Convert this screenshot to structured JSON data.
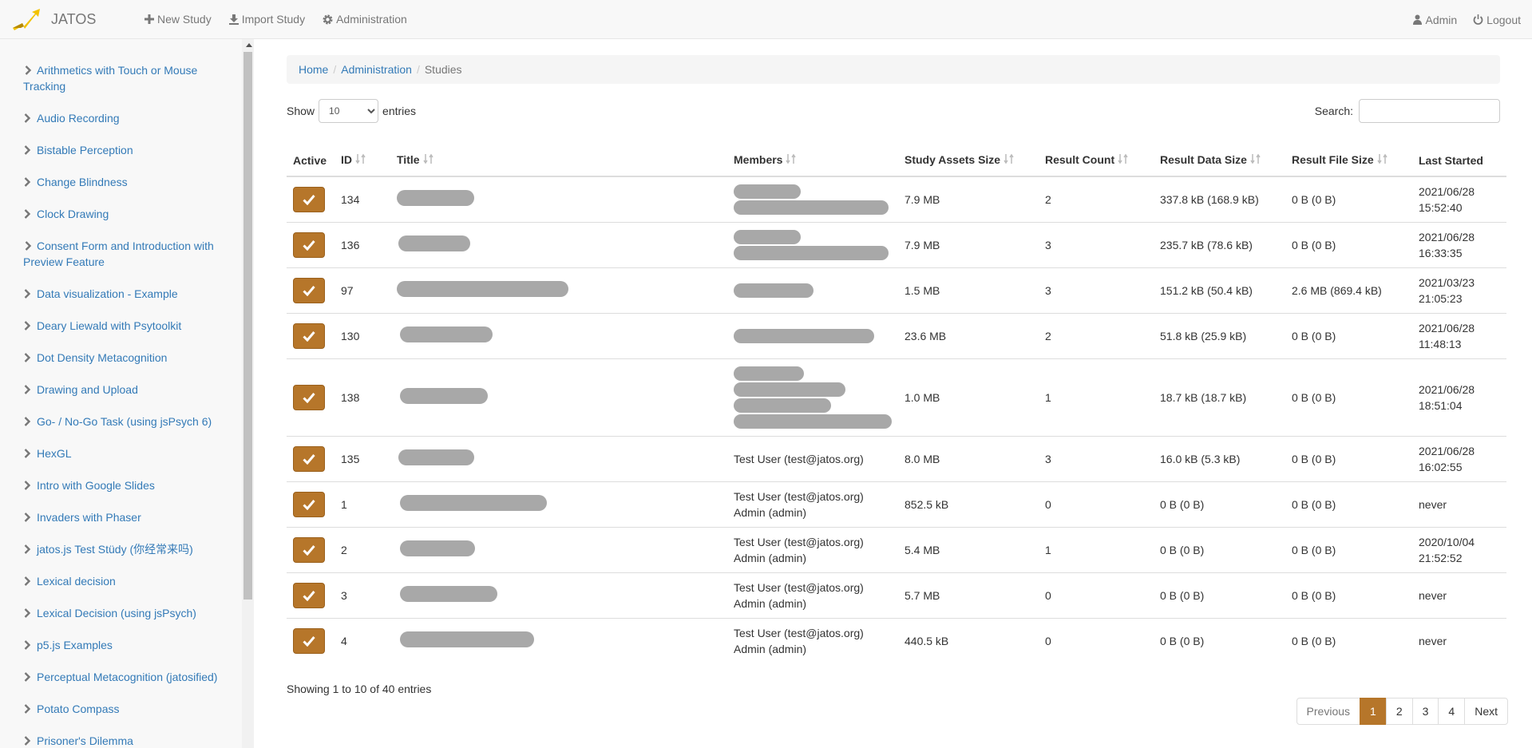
{
  "navbar": {
    "brand": "JATOS",
    "new_study": "New Study",
    "import_study": "Import Study",
    "administration": "Administration",
    "user": "Admin",
    "logout": "Logout"
  },
  "sidebar": {
    "items": [
      {
        "label": "Arithmetics with Touch or Mouse Tracking"
      },
      {
        "label": "Audio Recording"
      },
      {
        "label": "Bistable Perception"
      },
      {
        "label": "Change Blindness"
      },
      {
        "label": "Clock Drawing"
      },
      {
        "label": "Consent Form and Introduction with Preview Feature"
      },
      {
        "label": "Data visualization - Example"
      },
      {
        "label": "Deary Liewald with Psytoolkit"
      },
      {
        "label": "Dot Density Metacognition"
      },
      {
        "label": "Drawing and Upload"
      },
      {
        "label": "Go- / No-Go Task (using jsPsych 6)"
      },
      {
        "label": "HexGL"
      },
      {
        "label": "Intro with Google Slides"
      },
      {
        "label": "Invaders with Phaser"
      },
      {
        "label": "jatos.js Test Stüdy (你经常来吗)"
      },
      {
        "label": "Lexical decision"
      },
      {
        "label": "Lexical Decision (using jsPsych)"
      },
      {
        "label": "p5.js Examples"
      },
      {
        "label": "Perceptual Metacognition (jatosified)"
      },
      {
        "label": "Potato Compass"
      },
      {
        "label": "Prisoner's Dilemma"
      }
    ]
  },
  "breadcrumb": {
    "home": "Home",
    "administration": "Administration",
    "current": "Studies"
  },
  "controls": {
    "show_label": "Show",
    "entries_label": "entries",
    "page_size": "10",
    "search_label": "Search:",
    "search_value": ""
  },
  "table": {
    "headers": {
      "active": "Active",
      "id": "ID",
      "title": "Title",
      "members": "Members",
      "assets": "Study Assets Size",
      "result_count": "Result Count",
      "result_data": "Result Data Size",
      "result_file": "Result File Size",
      "last_started": "Last Started"
    },
    "rows": [
      {
        "id": "134",
        "members": [
          "",
          "",
          "",
          ""
        ],
        "assets": "7.9 MB",
        "count": "2",
        "data": "337.8 kB (168.9 kB)",
        "file": "0 B (0 B)",
        "started1": "2021/06/28",
        "started2": "15:52:40"
      },
      {
        "id": "136",
        "members": [
          "",
          "",
          "",
          ""
        ],
        "assets": "7.9 MB",
        "count": "3",
        "data": "235.7 kB (78.6 kB)",
        "file": "0 B (0 B)",
        "started1": "2021/06/28",
        "started2": "16:33:35"
      },
      {
        "id": "97",
        "members": [
          "",
          "",
          "",
          ""
        ],
        "assets": "1.5 MB",
        "count": "3",
        "data": "151.2 kB (50.4 kB)",
        "file": "2.6 MB (869.4 kB)",
        "started1": "2021/03/23",
        "started2": "21:05:23"
      },
      {
        "id": "130",
        "members": [
          "",
          "",
          "",
          ""
        ],
        "assets": "23.6 MB",
        "count": "2",
        "data": "51.8 kB (25.9 kB)",
        "file": "0 B (0 B)",
        "started1": "2021/06/28",
        "started2": "11:48:13"
      },
      {
        "id": "138",
        "members": [
          "",
          "",
          "",
          ""
        ],
        "assets": "1.0 MB",
        "count": "1",
        "data": "18.7 kB (18.7 kB)",
        "file": "0 B (0 B)",
        "started1": "2021/06/28",
        "started2": "18:51:04"
      },
      {
        "id": "135",
        "members": [
          "Test User (test@jatos.org)",
          ""
        ],
        "assets": "8.0 MB",
        "count": "3",
        "data": "16.0 kB (5.3 kB)",
        "file": "0 B (0 B)",
        "started1": "2021/06/28",
        "started2": "16:02:55"
      },
      {
        "id": "1",
        "members": [
          "Test User (test@jatos.org)",
          "Admin (admin)"
        ],
        "assets": "852.5 kB",
        "count": "0",
        "data": "0 B (0 B)",
        "file": "0 B (0 B)",
        "started1": "never",
        "started2": ""
      },
      {
        "id": "2",
        "members": [
          "Test User (test@jatos.org)",
          "Admin (admin)"
        ],
        "assets": "5.4 MB",
        "count": "1",
        "data": "0 B (0 B)",
        "file": "0 B (0 B)",
        "started1": "2020/10/04",
        "started2": "21:52:52"
      },
      {
        "id": "3",
        "members": [
          "Test User (test@jatos.org)",
          "Admin (admin)"
        ],
        "assets": "5.7 MB",
        "count": "0",
        "data": "0 B (0 B)",
        "file": "0 B (0 B)",
        "started1": "never",
        "started2": ""
      },
      {
        "id": "4",
        "members": [
          "Test User (test@jatos.org)",
          "Admin (admin)"
        ],
        "assets": "440.5 kB",
        "count": "0",
        "data": "0 B (0 B)",
        "file": "0 B (0 B)",
        "started1": "never",
        "started2": ""
      }
    ]
  },
  "info": "Showing 1 to 10 of 40 entries",
  "pagination": {
    "previous": "Previous",
    "pages": [
      "1",
      "2",
      "3",
      "4"
    ],
    "next": "Next",
    "current": "1"
  },
  "colors": {
    "accent": "#b6762a",
    "link": "#337ab7",
    "navbar_bg": "#f8f8f8"
  }
}
